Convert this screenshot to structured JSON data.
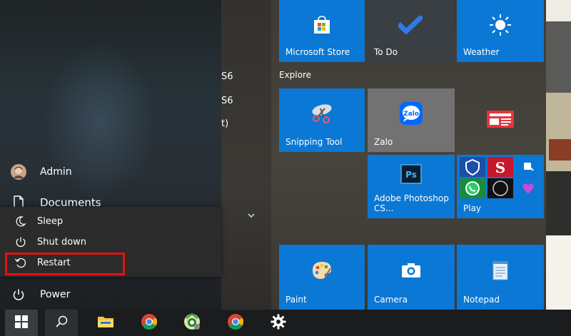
{
  "left_menu": {
    "user_name": "Admin",
    "documents_label": "Documents",
    "power_label": "Power",
    "expand_arrow": "chevron-down-icon"
  },
  "power_menu": {
    "items": [
      {
        "label": "Sleep",
        "icon": "moon-icon"
      },
      {
        "label": "Shut down",
        "icon": "power-icon"
      },
      {
        "label": "Restart",
        "icon": "restart-icon"
      }
    ],
    "highlight_color": "#e31212"
  },
  "hidden_app_fragments": [
    "S6",
    "S6",
    "t)"
  ],
  "tiles": {
    "top_row": [
      {
        "label": "Microsoft Store",
        "icon": "store-bag-icon"
      },
      {
        "label": "To Do",
        "icon": "checkmark-icon"
      },
      {
        "label": "Weather",
        "icon": "sun-icon"
      }
    ],
    "explore_label": "Explore",
    "explore": [
      {
        "label": "Snipping Tool",
        "icon": "scissors-icon"
      },
      {
        "label": "Zalo",
        "icon": "zalo-icon"
      },
      {
        "label": "",
        "icon": "news-icon"
      },
      {
        "label": "Adobe Photoshop CS...",
        "icon": "photoshop-icon",
        "icon_text": "Ps"
      },
      {
        "label": "Play",
        "icon": "play-folder-icon"
      }
    ],
    "bottom_row": [
      {
        "label": "Paint",
        "icon": "palette-icon"
      },
      {
        "label": "Camera",
        "icon": "camera-icon"
      },
      {
        "label": "Notepad",
        "icon": "notepad-icon"
      }
    ],
    "play_mini": [
      {
        "icon": "hotspot-shield-icon"
      },
      {
        "icon": "superlink-icon"
      },
      {
        "icon": "lock-app-icon"
      },
      {
        "icon": "whatsapp-icon"
      },
      {
        "icon": "circle-app-icon"
      },
      {
        "icon": "picsart-icon"
      }
    ],
    "accent_color": "#0a78d4"
  },
  "taskbar": {
    "items": [
      {
        "icon": "windows-start-icon"
      },
      {
        "icon": "search-icon"
      },
      {
        "icon": "file-explorer-icon"
      },
      {
        "icon": "chrome-icon"
      },
      {
        "icon": "coc-coc-icon"
      },
      {
        "icon": "chrome-icon"
      },
      {
        "icon": "settings-gear-icon"
      }
    ]
  }
}
